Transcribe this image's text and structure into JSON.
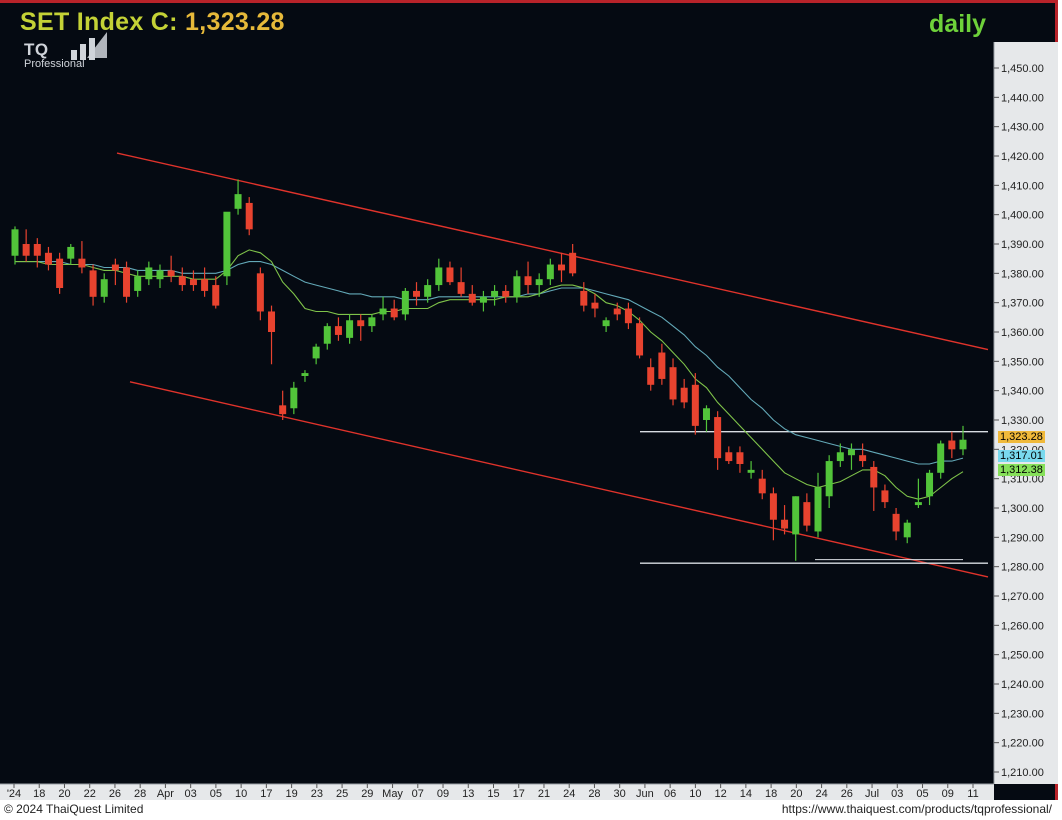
{
  "header": {
    "title_prefix": "SET Index C: ",
    "title_value": "1,323.28",
    "period": "daily"
  },
  "logo": {
    "brand": "TQ",
    "tagline": "Professional"
  },
  "footer": {
    "copyright": "© 2024 ThaiQuest Limited",
    "url": "https://www.thaiquest.com/products/tqprofessional/"
  },
  "colors": {
    "background": "#050a12",
    "up_candle": "#52c43a",
    "down_candle": "#e8432f",
    "ma_short": "#7fc34a",
    "ma_long": "#63a9b8",
    "trendline": "#e0332b",
    "support_resistance": "#d8dde2",
    "title": "#c4d236",
    "price_badge": "#f0b93a",
    "ma_long_badge": "#79d9ee",
    "ma_short_badge": "#86e05a"
  },
  "chart_data": {
    "type": "candlestick",
    "title": "SET Index C: 1,323.28",
    "period": "daily",
    "ylim": [
      1205,
      1455
    ],
    "y_ticks": [
      "1,450.00",
      "1,440.00",
      "1,430.00",
      "1,420.00",
      "1,410.00",
      "1,400.00",
      "1,390.00",
      "1,380.00",
      "1,370.00",
      "1,360.00",
      "1,350.00",
      "1,340.00",
      "1,330.00",
      "1,320.00",
      "1,310.00",
      "1,300.00",
      "1,290.00",
      "1,280.00",
      "1,270.00",
      "1,260.00",
      "1,250.00",
      "1,240.00",
      "1,230.00",
      "1,220.00",
      "1,210.00"
    ],
    "x_tick_labels": [
      "'24",
      "18",
      "20",
      "22",
      "26",
      "28",
      "Apr",
      "03",
      "05",
      "10",
      "17",
      "19",
      "23",
      "25",
      "29",
      "May",
      "07",
      "09",
      "13",
      "15",
      "17",
      "21",
      "24",
      "28",
      "30",
      "Jun",
      "06",
      "10",
      "12",
      "14",
      "18",
      "20",
      "24",
      "26",
      "Jul",
      "03",
      "05",
      "09",
      "11"
    ],
    "last_values": {
      "close": "1,323.28",
      "ma_long": "1,317.01",
      "ma_short": "1,312.38"
    },
    "candles": [
      {
        "o": 1386,
        "h": 1396,
        "l": 1383,
        "c": 1395
      },
      {
        "o": 1390,
        "h": 1395,
        "l": 1384,
        "c": 1386
      },
      {
        "o": 1390,
        "h": 1392,
        "l": 1382,
        "c": 1386
      },
      {
        "o": 1387,
        "h": 1389,
        "l": 1381,
        "c": 1383
      },
      {
        "o": 1385,
        "h": 1387,
        "l": 1373,
        "c": 1375
      },
      {
        "o": 1385,
        "h": 1390,
        "l": 1383,
        "c": 1389
      },
      {
        "o": 1385,
        "h": 1391,
        "l": 1380,
        "c": 1382
      },
      {
        "o": 1381,
        "h": 1383,
        "l": 1369,
        "c": 1372
      },
      {
        "o": 1372,
        "h": 1380,
        "l": 1370,
        "c": 1378
      },
      {
        "o": 1383,
        "h": 1385,
        "l": 1376,
        "c": 1381
      },
      {
        "o": 1382,
        "h": 1384,
        "l": 1370,
        "c": 1372
      },
      {
        "o": 1374,
        "h": 1381,
        "l": 1372,
        "c": 1379
      },
      {
        "o": 1378,
        "h": 1384,
        "l": 1376,
        "c": 1382
      },
      {
        "o": 1378,
        "h": 1383,
        "l": 1375,
        "c": 1381
      },
      {
        "o": 1381,
        "h": 1386,
        "l": 1377,
        "c": 1379
      },
      {
        "o": 1379,
        "h": 1382,
        "l": 1374,
        "c": 1376
      },
      {
        "o": 1378,
        "h": 1381,
        "l": 1374,
        "c": 1376
      },
      {
        "o": 1378,
        "h": 1382,
        "l": 1372,
        "c": 1374
      },
      {
        "o": 1376,
        "h": 1379,
        "l": 1368,
        "c": 1369
      },
      {
        "o": 1379,
        "h": 1397,
        "l": 1376,
        "c": 1401
      },
      {
        "o": 1402,
        "h": 1412,
        "l": 1400,
        "c": 1407
      },
      {
        "o": 1404,
        "h": 1406,
        "l": 1393,
        "c": 1395
      },
      {
        "o": 1380,
        "h": 1382,
        "l": 1364,
        "c": 1367
      },
      {
        "o": 1367,
        "h": 1369,
        "l": 1349,
        "c": 1360
      },
      {
        "o": 1335,
        "h": 1340,
        "l": 1330,
        "c": 1332
      },
      {
        "o": 1334,
        "h": 1343,
        "l": 1332,
        "c": 1341
      },
      {
        "o": 1345,
        "h": 1347,
        "l": 1343,
        "c": 1346
      },
      {
        "o": 1351,
        "h": 1356,
        "l": 1349,
        "c": 1355
      },
      {
        "o": 1356,
        "h": 1363,
        "l": 1354,
        "c": 1362
      },
      {
        "o": 1362,
        "h": 1365,
        "l": 1357,
        "c": 1359
      },
      {
        "o": 1358,
        "h": 1366,
        "l": 1356,
        "c": 1364
      },
      {
        "o": 1364,
        "h": 1366,
        "l": 1357,
        "c": 1362
      },
      {
        "o": 1362,
        "h": 1366,
        "l": 1360,
        "c": 1365
      },
      {
        "o": 1366,
        "h": 1372,
        "l": 1364,
        "c": 1368
      },
      {
        "o": 1368,
        "h": 1371,
        "l": 1364,
        "c": 1365
      },
      {
        "o": 1366,
        "h": 1375,
        "l": 1364,
        "c": 1374
      },
      {
        "o": 1374,
        "h": 1377,
        "l": 1369,
        "c": 1372
      },
      {
        "o": 1372,
        "h": 1378,
        "l": 1370,
        "c": 1376
      },
      {
        "o": 1376,
        "h": 1385,
        "l": 1374,
        "c": 1382
      },
      {
        "o": 1382,
        "h": 1384,
        "l": 1376,
        "c": 1377
      },
      {
        "o": 1377,
        "h": 1382,
        "l": 1372,
        "c": 1373
      },
      {
        "o": 1373,
        "h": 1376,
        "l": 1369,
        "c": 1370
      },
      {
        "o": 1370,
        "h": 1374,
        "l": 1367,
        "c": 1372
      },
      {
        "o": 1372,
        "h": 1376,
        "l": 1369,
        "c": 1374
      },
      {
        "o": 1374,
        "h": 1376,
        "l": 1370,
        "c": 1372
      },
      {
        "o": 1372,
        "h": 1381,
        "l": 1370,
        "c": 1379
      },
      {
        "o": 1379,
        "h": 1384,
        "l": 1373,
        "c": 1376
      },
      {
        "o": 1376,
        "h": 1380,
        "l": 1372,
        "c": 1378
      },
      {
        "o": 1378,
        "h": 1385,
        "l": 1376,
        "c": 1383
      },
      {
        "o": 1383,
        "h": 1387,
        "l": 1377,
        "c": 1381
      },
      {
        "o": 1387,
        "h": 1390,
        "l": 1379,
        "c": 1380
      },
      {
        "o": 1374,
        "h": 1377,
        "l": 1367,
        "c": 1369
      },
      {
        "o": 1370,
        "h": 1373,
        "l": 1365,
        "c": 1368
      },
      {
        "o": 1362,
        "h": 1365,
        "l": 1360,
        "c": 1364
      },
      {
        "o": 1368,
        "h": 1370,
        "l": 1364,
        "c": 1366
      },
      {
        "o": 1368,
        "h": 1370,
        "l": 1361,
        "c": 1363
      },
      {
        "o": 1363,
        "h": 1365,
        "l": 1351,
        "c": 1352
      },
      {
        "o": 1348,
        "h": 1351,
        "l": 1340,
        "c": 1342
      },
      {
        "o": 1353,
        "h": 1356,
        "l": 1342,
        "c": 1344
      },
      {
        "o": 1348,
        "h": 1351,
        "l": 1335,
        "c": 1337
      },
      {
        "o": 1341,
        "h": 1344,
        "l": 1334,
        "c": 1336
      },
      {
        "o": 1342,
        "h": 1346,
        "l": 1325,
        "c": 1328
      },
      {
        "o": 1330,
        "h": 1335,
        "l": 1326,
        "c": 1334
      },
      {
        "o": 1331,
        "h": 1333,
        "l": 1313,
        "c": 1317
      },
      {
        "o": 1319,
        "h": 1321,
        "l": 1315,
        "c": 1316
      },
      {
        "o": 1319,
        "h": 1321,
        "l": 1312,
        "c": 1315
      },
      {
        "o": 1312,
        "h": 1316,
        "l": 1310,
        "c": 1313
      },
      {
        "o": 1310,
        "h": 1313,
        "l": 1303,
        "c": 1305
      },
      {
        "o": 1305,
        "h": 1307,
        "l": 1289,
        "c": 1296
      },
      {
        "o": 1296,
        "h": 1301,
        "l": 1291,
        "c": 1293
      },
      {
        "o": 1291,
        "h": 1304,
        "l": 1282,
        "c": 1304
      },
      {
        "o": 1302,
        "h": 1305,
        "l": 1292,
        "c": 1294
      },
      {
        "o": 1292,
        "h": 1312,
        "l": 1290,
        "c": 1307
      },
      {
        "o": 1304,
        "h": 1318,
        "l": 1300,
        "c": 1316
      },
      {
        "o": 1316,
        "h": 1322,
        "l": 1314,
        "c": 1319
      },
      {
        "o": 1318,
        "h": 1322,
        "l": 1313,
        "c": 1320
      },
      {
        "o": 1318,
        "h": 1322,
        "l": 1314,
        "c": 1316
      },
      {
        "o": 1314,
        "h": 1316,
        "l": 1299,
        "c": 1307
      },
      {
        "o": 1306,
        "h": 1308,
        "l": 1300,
        "c": 1302
      },
      {
        "o": 1298,
        "h": 1300,
        "l": 1289,
        "c": 1292
      },
      {
        "o": 1290,
        "h": 1296,
        "l": 1288,
        "c": 1295
      },
      {
        "o": 1301,
        "h": 1310,
        "l": 1300,
        "c": 1302
      },
      {
        "o": 1304,
        "h": 1313,
        "l": 1301,
        "c": 1312
      },
      {
        "o": 1312,
        "h": 1323,
        "l": 1310,
        "c": 1322
      },
      {
        "o": 1323,
        "h": 1326,
        "l": 1317,
        "c": 1320
      },
      {
        "o": 1320,
        "h": 1328,
        "l": 1318,
        "c": 1323.28
      }
    ],
    "ma_short": [
      1384,
      1384,
      1384,
      1383,
      1383,
      1383,
      1383,
      1382,
      1381,
      1381,
      1380,
      1379,
      1379,
      1379,
      1379,
      1379,
      1378,
      1378,
      1378,
      1381,
      1386,
      1388,
      1387,
      1384,
      1377,
      1373,
      1368,
      1367,
      1367,
      1366,
      1366,
      1366,
      1366,
      1367,
      1367,
      1368,
      1368,
      1368,
      1370,
      1371,
      1371,
      1371,
      1371,
      1371,
      1372,
      1372,
      1372,
      1373,
      1375,
      1376,
      1376,
      1375,
      1373,
      1370,
      1369,
      1367,
      1364,
      1360,
      1357,
      1353,
      1349,
      1344,
      1341,
      1336,
      1332,
      1328,
      1324,
      1320,
      1316,
      1312,
      1310,
      1308,
      1307,
      1308,
      1309,
      1311,
      1313,
      1313,
      1311,
      1307,
      1304,
      1303,
      1304,
      1307,
      1310,
      1312.38
    ],
    "ma_long": [
      1384,
      1384,
      1384,
      1384,
      1384,
      1383,
      1383,
      1383,
      1382,
      1382,
      1382,
      1381,
      1381,
      1381,
      1381,
      1380,
      1380,
      1380,
      1380,
      1381,
      1383,
      1384,
      1384,
      1383,
      1381,
      1379,
      1377,
      1376,
      1375,
      1374,
      1373,
      1373,
      1372,
      1372,
      1372,
      1371,
      1371,
      1371,
      1372,
      1372,
      1372,
      1372,
      1372,
      1372,
      1372,
      1372,
      1373,
      1373,
      1374,
      1375,
      1375,
      1375,
      1374,
      1373,
      1372,
      1371,
      1369,
      1367,
      1365,
      1362,
      1359,
      1355,
      1352,
      1348,
      1345,
      1341,
      1337,
      1334,
      1330,
      1327,
      1325,
      1324,
      1323,
      1322,
      1321,
      1320,
      1320,
      1319,
      1318,
      1317,
      1316,
      1315,
      1315,
      1316,
      1316,
      1317.01
    ],
    "trendlines": [
      {
        "x0": 9,
        "y0": 1421,
        "x1": 99,
        "y1": 1354
      },
      {
        "x0": 10,
        "y0": 1343,
        "x1": 99,
        "y1": 1276
      },
      {
        "x0": 55,
        "y0": 1326,
        "x1": 99,
        "y1": 1326
      },
      {
        "x0": 55,
        "y0": 1281,
        "x1": 99,
        "y1": 1281
      }
    ]
  }
}
